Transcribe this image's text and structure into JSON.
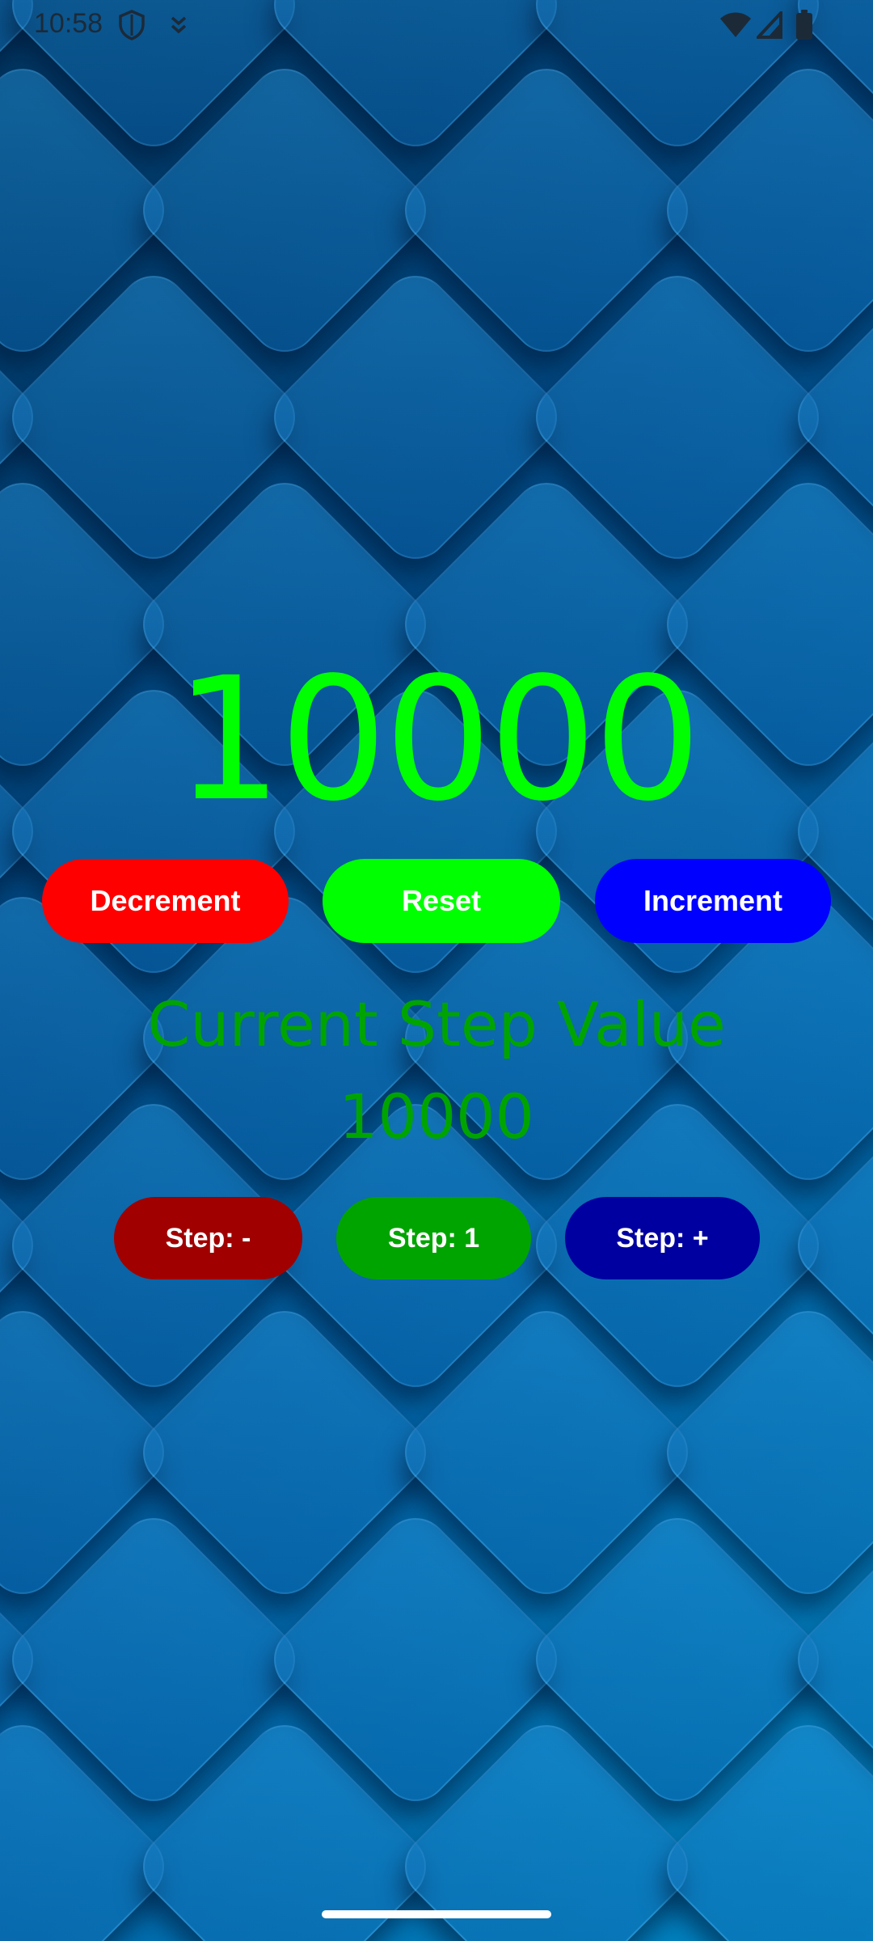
{
  "status_bar": {
    "time": "10:58",
    "icons": [
      "shield-icon",
      "download-icon",
      "wifi-icon",
      "signal-icon",
      "battery-icon"
    ]
  },
  "counter": {
    "value": "10000",
    "color": "#00ff00"
  },
  "buttons": {
    "decrement_label": "Decrement",
    "reset_label": "Reset",
    "increment_label": "Increment",
    "decrement_color": "#ff0000",
    "reset_color": "#00ff00",
    "increment_color": "#0000ff"
  },
  "step": {
    "title": "Current Step Value",
    "value": "10000",
    "color": "#00a400"
  },
  "step_buttons": {
    "minus_label": "Step: -",
    "reset_label": "Step: 1",
    "plus_label": "Step: +",
    "minus_color": "#a00000",
    "reset_color": "#00a400",
    "plus_color": "#0000a0"
  }
}
